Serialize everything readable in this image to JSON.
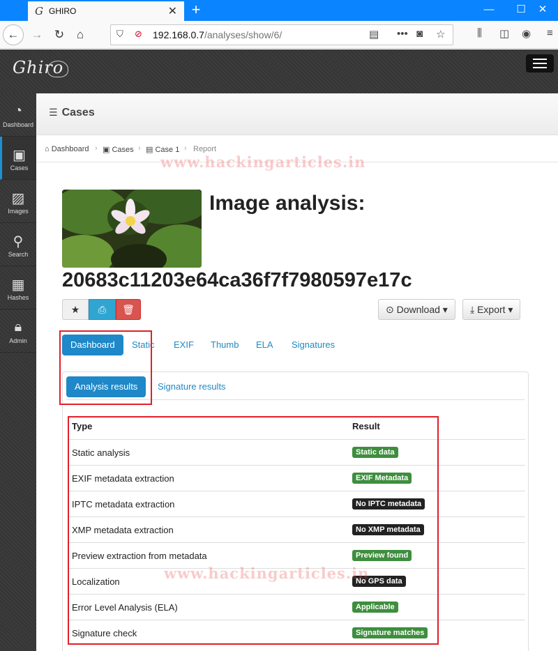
{
  "browser": {
    "tab_title": "GHIRO",
    "url_host": "192.168.0.7",
    "url_path": "/analyses/show/6/"
  },
  "app": {
    "logo_text": "Ghiro"
  },
  "sidebar": {
    "items": [
      {
        "label": "Dashboard",
        "icon": "dashboard-icon"
      },
      {
        "label": "Cases",
        "icon": "briefcase-icon"
      },
      {
        "label": "Images",
        "icon": "image-icon"
      },
      {
        "label": "Search",
        "icon": "search-icon"
      },
      {
        "label": "Hashes",
        "icon": "grid-icon"
      },
      {
        "label": "Admin",
        "icon": "lock-icon"
      }
    ]
  },
  "page_header": {
    "title": "Cases"
  },
  "breadcrumb": [
    {
      "label": "Dashboard"
    },
    {
      "label": "Cases"
    },
    {
      "label": "Case 1"
    },
    {
      "label": "Report"
    }
  ],
  "analysis": {
    "title": "Image analysis:",
    "hash": "20683c11203e64ca36f7f7980597e17c",
    "download_label": "Download",
    "export_label": "Export"
  },
  "tabs": [
    {
      "label": "Dashboard"
    },
    {
      "label": "Static"
    },
    {
      "label": "EXIF"
    },
    {
      "label": "Thumb"
    },
    {
      "label": "ELA"
    },
    {
      "label": "Signatures"
    }
  ],
  "subtabs": [
    {
      "label": "Analysis results"
    },
    {
      "label": "Signature results"
    }
  ],
  "results": {
    "header_type": "Type",
    "header_result": "Result",
    "rows": [
      {
        "type": "Static analysis",
        "result": "Static data",
        "color": "#3e8e3e"
      },
      {
        "type": "EXIF metadata extraction",
        "result": "EXIF Metadata",
        "color": "#3e8e3e"
      },
      {
        "type": "IPTC metadata extraction",
        "result": "No IPTC metadata",
        "color": "#222222"
      },
      {
        "type": "XMP metadata extraction",
        "result": "No XMP metadata",
        "color": "#222222"
      },
      {
        "type": "Preview extraction from metadata",
        "result": "Preview found",
        "color": "#3e8e3e"
      },
      {
        "type": "Localization",
        "result": "No GPS data",
        "color": "#222222"
      },
      {
        "type": "Error Level Analysis (ELA)",
        "result": "Applicable",
        "color": "#3e8e3e"
      },
      {
        "type": "Signature check",
        "result": "Signature matches",
        "color": "#3e8e3e"
      }
    ]
  },
  "watermark": "www.hackingarticles.in",
  "colors": {
    "accent": "#1e88c8",
    "success": "#3e8e3e",
    "danger": "#d9534f",
    "highlight": "#e0202a"
  }
}
